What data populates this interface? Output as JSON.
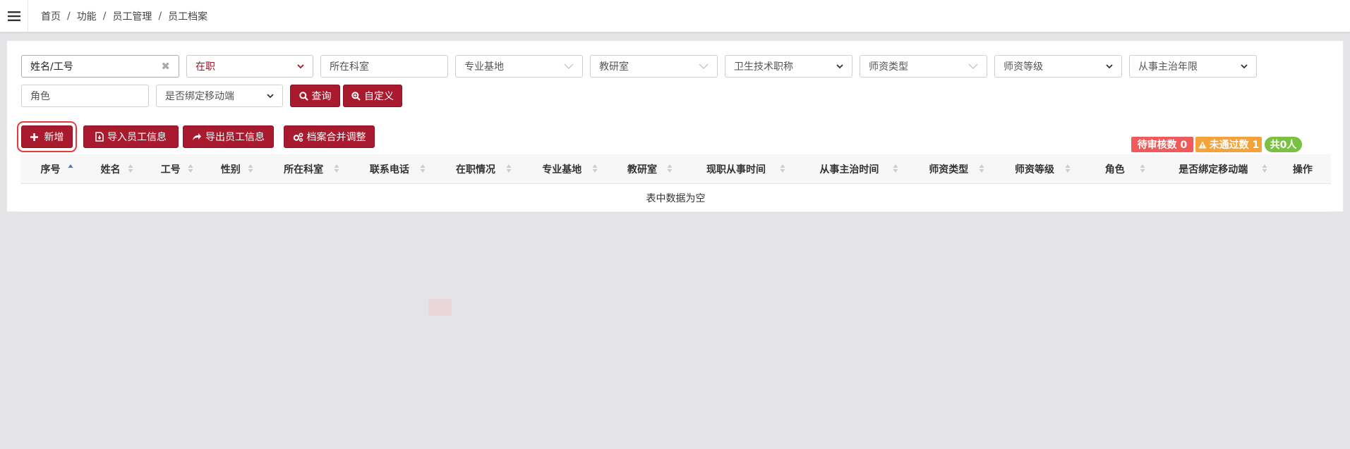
{
  "breadcrumb": [
    "首页",
    "功能",
    "员工管理",
    "员工档案"
  ],
  "filters": {
    "name_id": {
      "value": "姓名/工号"
    },
    "status": {
      "value": "在职"
    },
    "dept": {
      "placeholder": "所在科室"
    },
    "base": {
      "placeholder": "专业基地"
    },
    "room": {
      "placeholder": "教研室"
    },
    "title": {
      "value": "卫生技术职称"
    },
    "teacher_type": {
      "placeholder": "师资类型"
    },
    "teacher_level": {
      "value": "师资等级"
    },
    "years": {
      "value": "从事主治年限"
    },
    "role": {
      "placeholder": "角色"
    },
    "mobile": {
      "value": "是否绑定移动端"
    }
  },
  "actions": {
    "query": "查询",
    "custom": "自定义",
    "add": "新增",
    "import": "导入员工信息",
    "export": "导出员工信息",
    "merge": "档案合并调整"
  },
  "badges": {
    "pending": "待审核数 0",
    "failed": "未通过数 1",
    "total": "共0人"
  },
  "table": {
    "columns": [
      "序号",
      "姓名",
      "工号",
      "性别",
      "所在科室",
      "联系电话",
      "在职情况",
      "专业基地",
      "教研室",
      "现职从事时间",
      "从事主治时间",
      "师资类型",
      "师资等级",
      "角色",
      "是否绑定移动端",
      "操作"
    ],
    "empty_text": "表中数据为空"
  },
  "colors": {
    "primary": "#a81a2e",
    "pending": "#ef5b5b",
    "failed": "#f3a33a",
    "total": "#7ac142",
    "sort_active": "#3a7bd5"
  }
}
